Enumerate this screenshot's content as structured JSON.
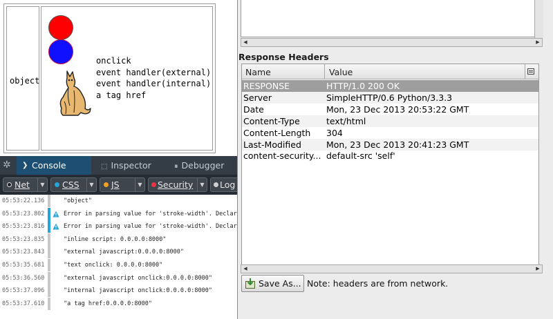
{
  "preview": {
    "object_label": "object",
    "links": [
      "onclick",
      "event handler(external)",
      "event handler(internal)",
      "a tag href"
    ]
  },
  "devtools": {
    "tabs": [
      {
        "label": "Console",
        "icon": "console-chevron-icon"
      },
      {
        "label": "Inspector",
        "icon": "inspector-icon"
      },
      {
        "label": "Debugger",
        "icon": "debugger-icon"
      }
    ],
    "filters": [
      {
        "label": "Net",
        "color": "#eeeeee"
      },
      {
        "label": "CSS",
        "color": "#26a6d8"
      },
      {
        "label": "JS",
        "color": "#f0a020"
      },
      {
        "label": "Security",
        "color": "#ee3344"
      },
      {
        "label": "Log",
        "color": "#cfcfcf"
      }
    ],
    "log": [
      {
        "time": "05:53:22.136",
        "msg": "\"object\"",
        "warn": false
      },
      {
        "time": "05:53:23.802",
        "msg": "Error in parsing value for 'stroke-width'.  Declar",
        "warn": true
      },
      {
        "time": "05:53:23.816",
        "msg": "Error in parsing value for 'stroke-width'.  Declar",
        "warn": true
      },
      {
        "time": "05:53:23.835",
        "msg": "\"inline script: 0.0.0.0:8000\"",
        "warn": false
      },
      {
        "time": "05:53:23.843",
        "msg": "\"external javascript:0.0.0.0:8000\"",
        "warn": false
      },
      {
        "time": "05:53:35.681",
        "msg": "\"text onclick: 0.0.0.0:8000\"",
        "warn": false
      },
      {
        "time": "05:53:36.560",
        "msg": "\"external javascript onclick:0.0.0.0:8000\"",
        "warn": false
      },
      {
        "time": "05:53:37.096",
        "msg": "\"internal javascript onclick:0.0.0.0:8000\"",
        "warn": false
      },
      {
        "time": "05:53:37.610",
        "msg": "\"a tag href:0.0.0.0:8000\"",
        "warn": false
      }
    ]
  },
  "network": {
    "section_title": "Response Headers",
    "columns": {
      "name": "Name",
      "value": "Value"
    },
    "rows": [
      {
        "name": "RESPONSE",
        "value": "HTTP/1.0 200 OK",
        "selected": true
      },
      {
        "name": "Server",
        "value": "SimpleHTTP/0.6 Python/3.3.3"
      },
      {
        "name": "Date",
        "value": "Mon, 23 Dec 2013 20:53:22 GMT"
      },
      {
        "name": "Content-Type",
        "value": "text/html"
      },
      {
        "name": "Content-Length",
        "value": "304"
      },
      {
        "name": "Last-Modified",
        "value": "Mon, 23 Dec 2013 20:41:23 GMT"
      },
      {
        "name": "content-security...",
        "value": "default-src 'self'"
      }
    ],
    "save_button": "Save As...",
    "note": "Note: headers are from network."
  }
}
